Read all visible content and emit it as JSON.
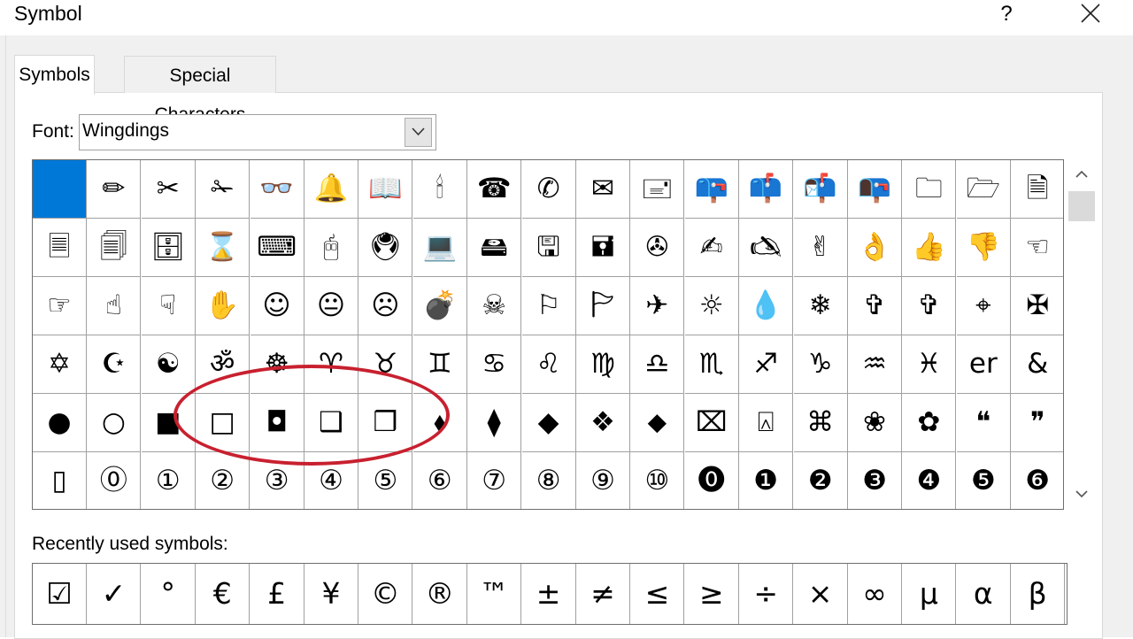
{
  "window": {
    "title": "Symbol",
    "help_label": "?"
  },
  "tabs": [
    {
      "label": "Symbols",
      "active": true
    },
    {
      "label": "Special Characters",
      "active": false
    }
  ],
  "font": {
    "label": "Font:",
    "value": "Wingdings"
  },
  "symbol_grid": {
    "selected_index": 0,
    "rows": [
      [
        "",
        "✏",
        "✂",
        "✁",
        "👓",
        "🔔",
        "📖",
        "🕯",
        "☎",
        "✆",
        "✉",
        "🖃",
        "📪",
        "📫",
        "📬",
        "📭",
        "🗀",
        "🗁",
        "🗎"
      ],
      [
        "🗏",
        "🗐",
        "🗄",
        "⌛",
        "⌨",
        "🖰",
        "🖲",
        "💻",
        "🖴",
        "🖫",
        "🖬",
        "✇",
        "✍",
        "🖎",
        "✌",
        "👌",
        "👍",
        "👎",
        "☜"
      ],
      [
        "☞",
        "☝",
        "☟",
        "✋",
        "☺",
        "😐",
        "☹",
        "💣",
        "☠",
        "⚐",
        "🏱",
        "✈",
        "☼",
        "💧",
        "❄",
        "✞",
        "✞",
        "⌖",
        "✠"
      ],
      [
        "✡",
        "☪",
        "☯",
        "ॐ",
        "☸",
        "♈",
        "♉",
        "♊",
        "♋",
        "♌",
        "♍",
        "♎",
        "♏",
        "♐",
        "♑",
        "♒",
        "♓",
        "er",
        "&"
      ],
      [
        "●",
        "○",
        "■",
        "□",
        "◘",
        "❑",
        "❒",
        "⬧",
        "⧫",
        "◆",
        "❖",
        "⬥",
        "⌧",
        "⍓",
        "⌘",
        "❀",
        "✿",
        "❝",
        "❞"
      ],
      [
        "▯",
        "⓪",
        "①",
        "②",
        "③",
        "④",
        "⑤",
        "⑥",
        "⑦",
        "⑧",
        "⑨",
        "⑩",
        "⓿",
        "❶",
        "❷",
        "❸",
        "❹",
        "❺",
        "❻"
      ]
    ]
  },
  "recent": {
    "label": "Recently used symbols:",
    "items": [
      "☑",
      "✓",
      "°",
      "€",
      "£",
      "¥",
      "©",
      "®",
      "™",
      "±",
      "≠",
      "≤",
      "≥",
      "÷",
      "×",
      "∞",
      "µ",
      "α",
      "β"
    ]
  },
  "colors": {
    "selection": "#0078d7",
    "annotation": "#c8202f"
  }
}
